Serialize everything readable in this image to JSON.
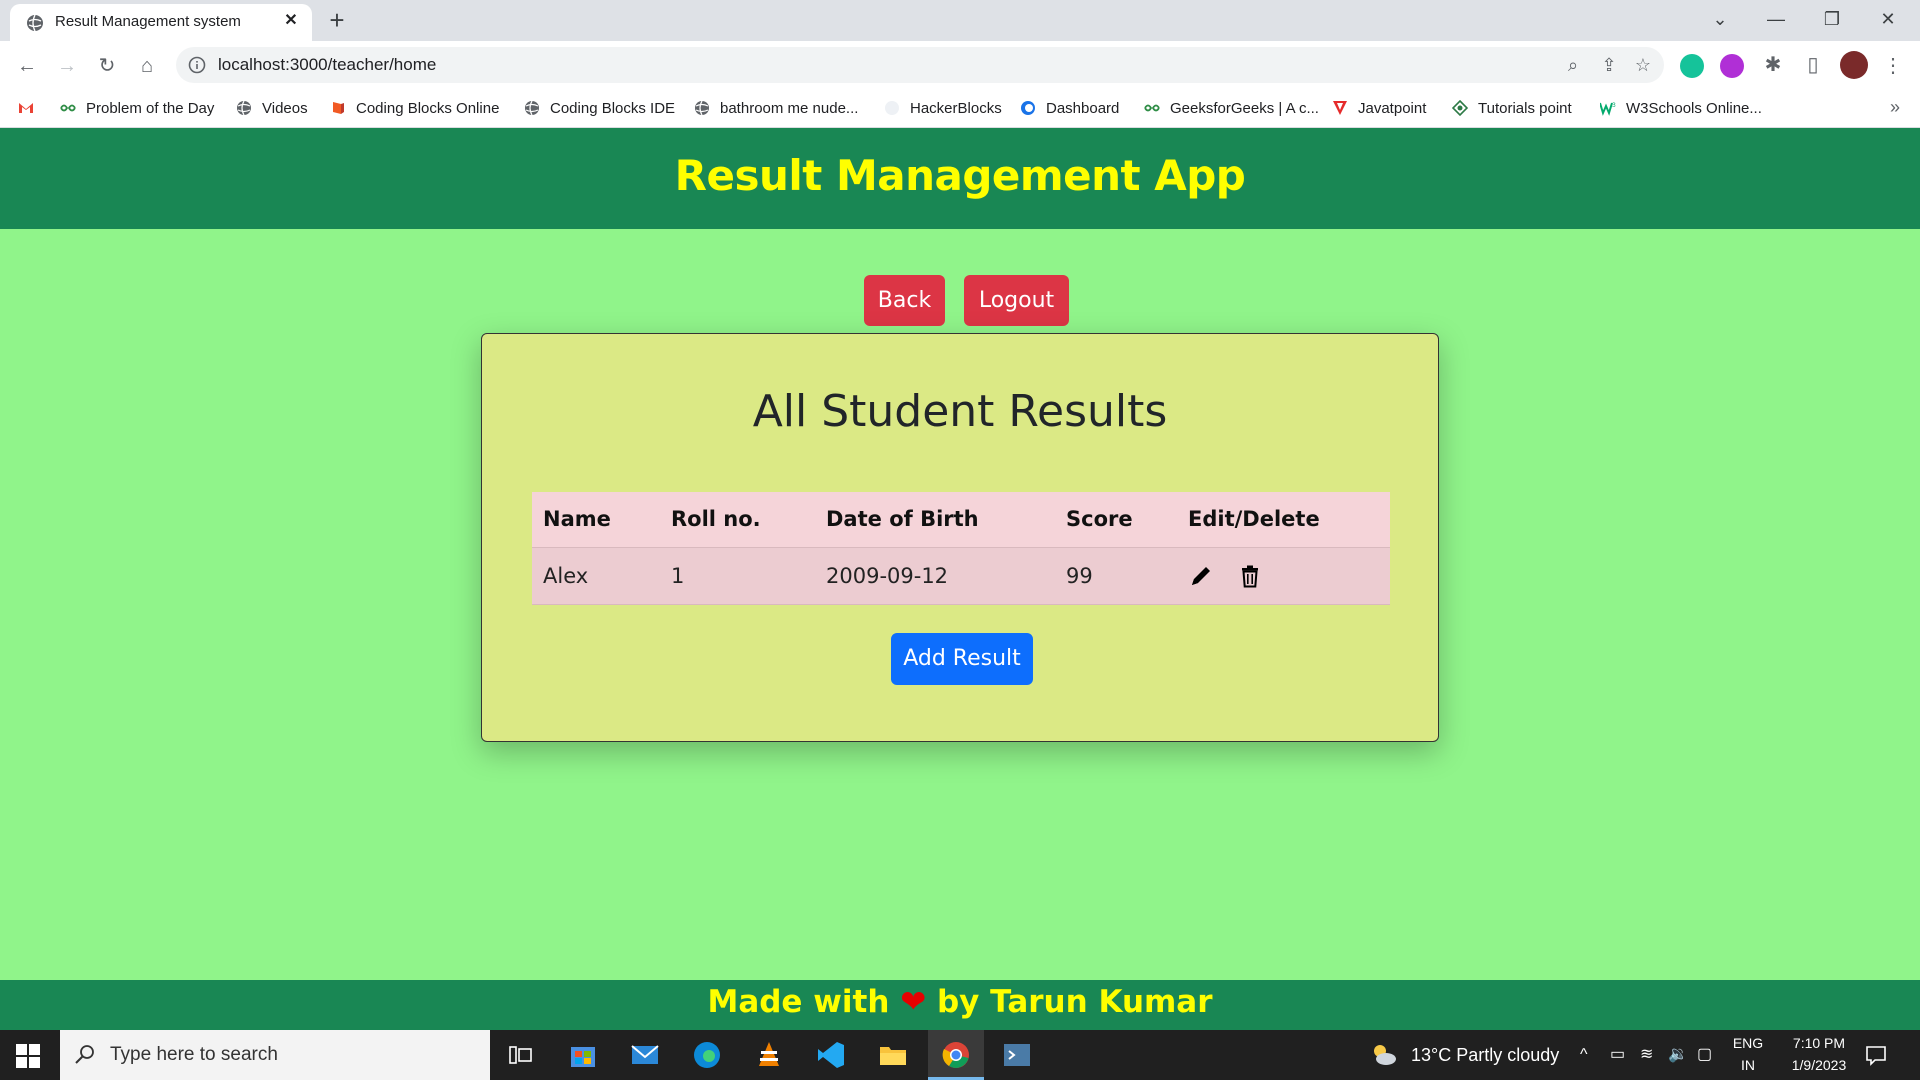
{
  "browser": {
    "tab_title": "Result Management system",
    "url": "localhost:3000/teacher/home",
    "bookmarks": [
      {
        "label": "Problem of the Day",
        "icon": "geeks-icon"
      },
      {
        "label": "Videos",
        "icon": "globe-icon"
      },
      {
        "label": "Coding Blocks Online",
        "icon": "codingblocks-icon"
      },
      {
        "label": "Coding Blocks IDE",
        "icon": "globe-icon"
      },
      {
        "label": "bathroom me nude...",
        "icon": "globe-icon"
      },
      {
        "label": "HackerBlocks",
        "icon": "hackerblocks-icon"
      },
      {
        "label": "Dashboard",
        "icon": "dashboard-icon"
      },
      {
        "label": "GeeksforGeeks | A c...",
        "icon": "geeks-icon"
      },
      {
        "label": "Javatpoint",
        "icon": "javatpoint-icon"
      },
      {
        "label": "Tutorials point",
        "icon": "tutorialspoint-icon"
      },
      {
        "label": "W3Schools Online...",
        "icon": "w3schools-icon"
      }
    ],
    "more_label": "»"
  },
  "app": {
    "title": "Result Management App",
    "back_label": "Back",
    "logout_label": "Logout",
    "card_title": "All Student Results",
    "columns": [
      "Name",
      "Roll no.",
      "Date of Birth",
      "Score",
      "Edit/Delete"
    ],
    "rows": [
      {
        "name": "Alex",
        "roll": "1",
        "dob": "2009-09-12",
        "score": "99"
      }
    ],
    "add_label": "Add Result",
    "footer_before": "Made with",
    "footer_heart": "❤",
    "footer_after": "by Tarun Kumar"
  },
  "taskbar": {
    "search_placeholder": "Type here to search",
    "weather": "13°C  Partly cloudy",
    "lang_top": "ENG",
    "lang_bottom": "IN",
    "time": "7:10 PM",
    "date": "1/9/2023"
  },
  "colors": {
    "page_bg": "#90f48a",
    "header_bg": "#198754",
    "title_yellow": "#ffff00",
    "card_bg": "#dbe985",
    "danger": "#dc3545",
    "primary": "#0d6efd"
  }
}
